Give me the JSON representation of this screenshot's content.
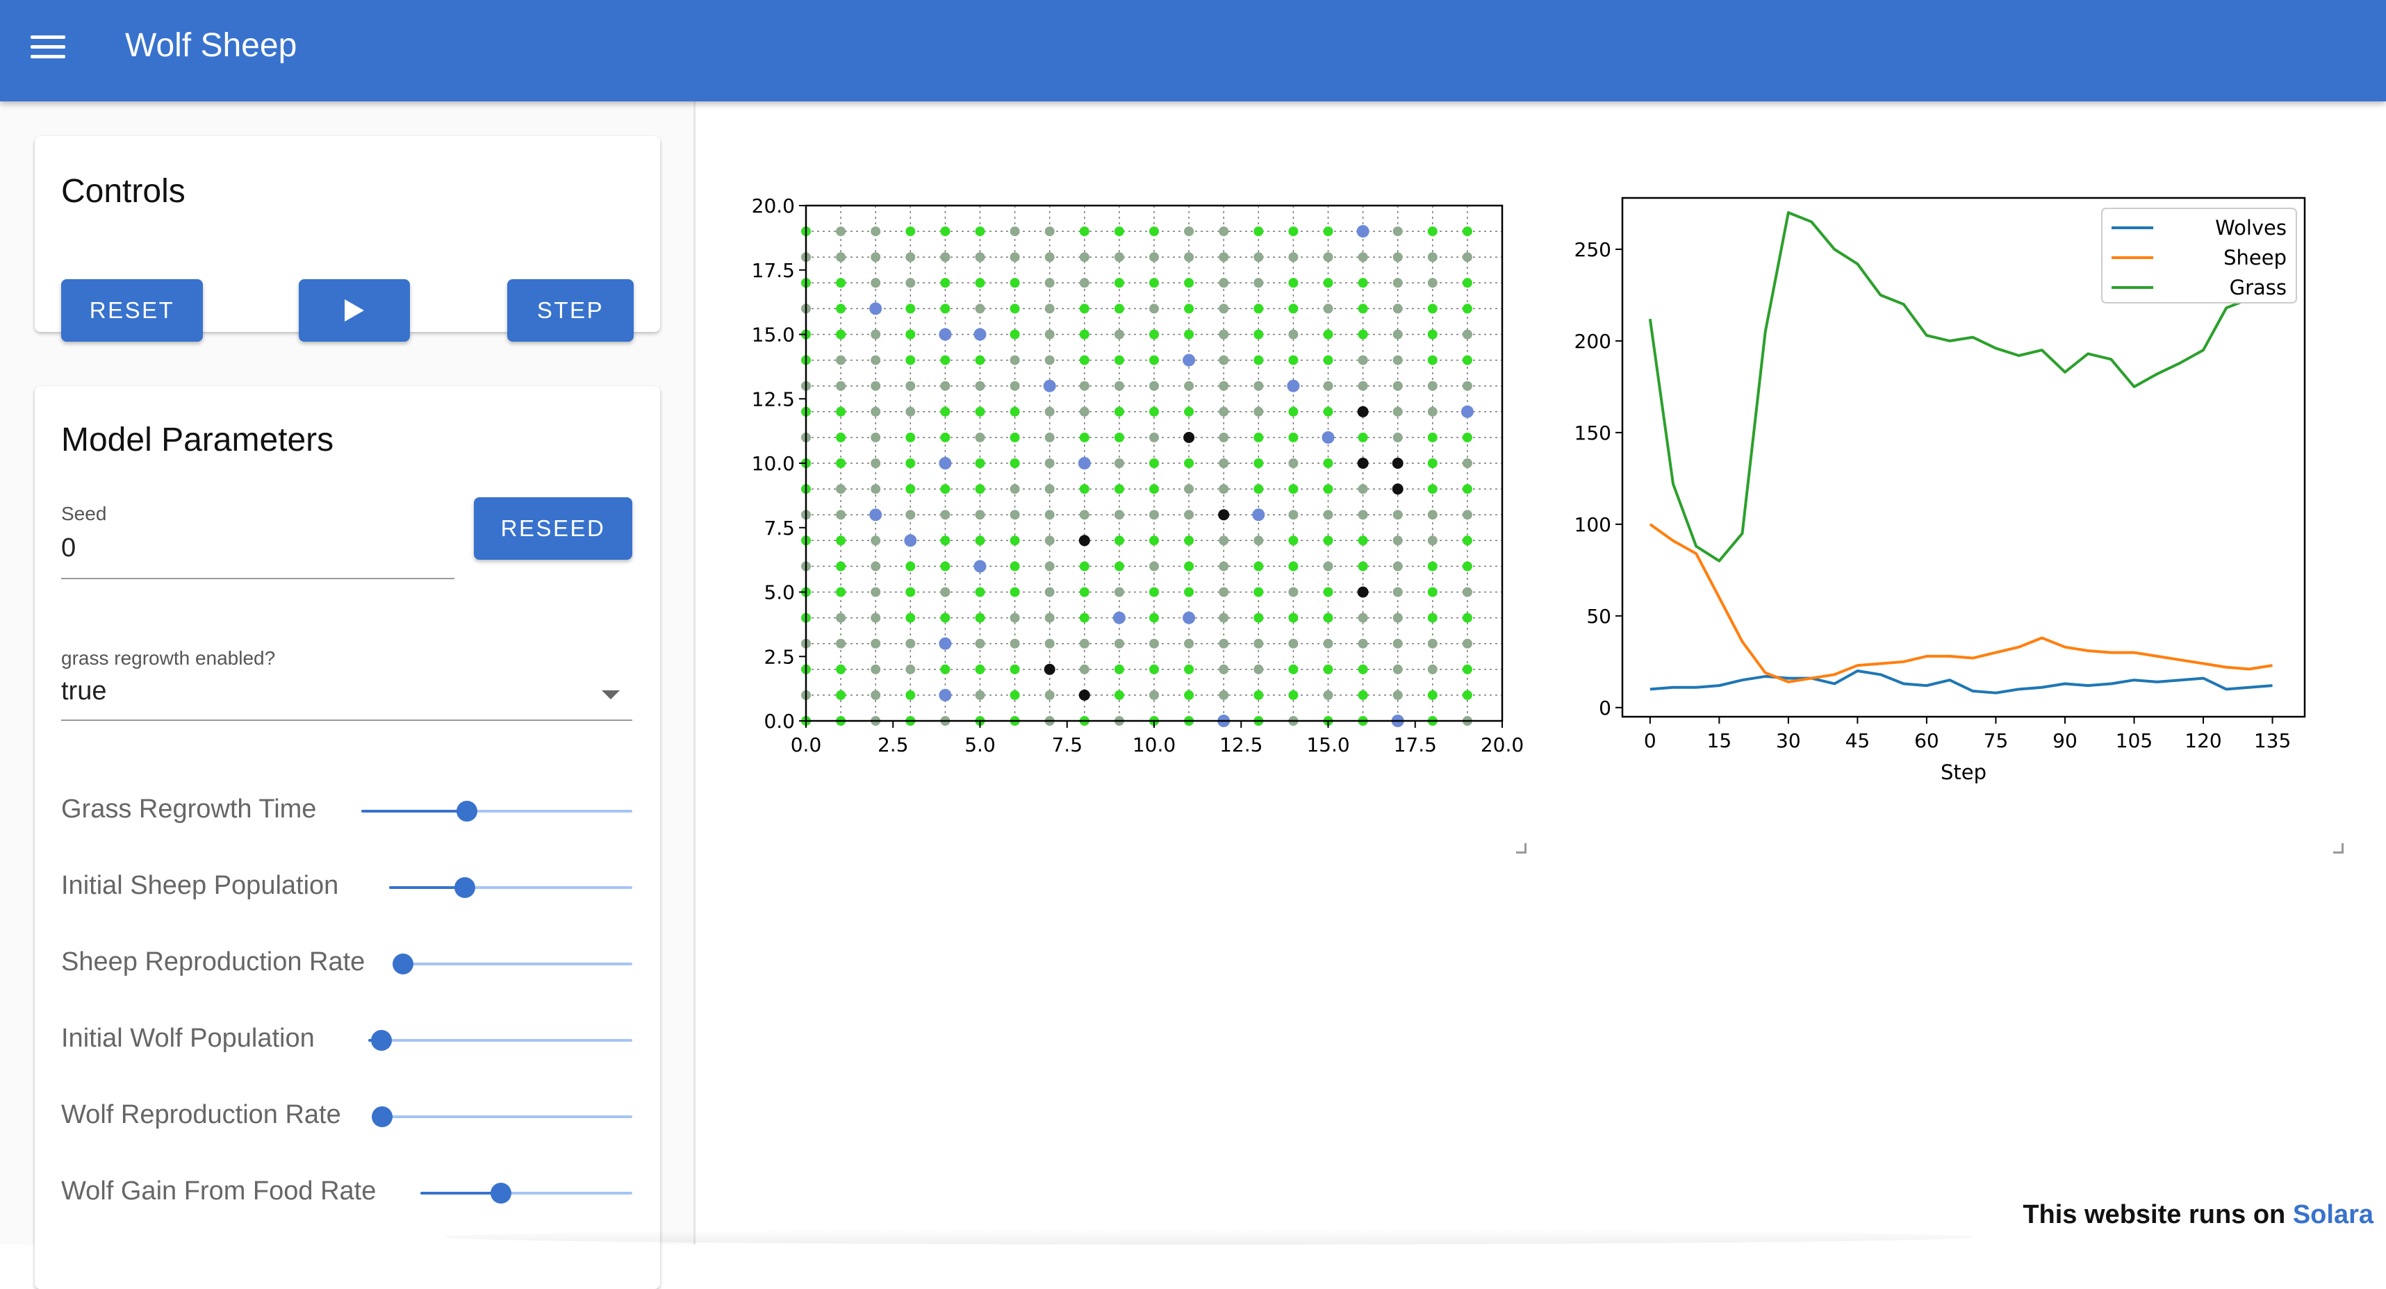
{
  "app": {
    "title": "Wolf Sheep"
  },
  "controls": {
    "title": "Controls",
    "reset_label": "RESET",
    "step_label": "STEP",
    "play_icon": "play-icon"
  },
  "model_parameters": {
    "title": "Model Parameters",
    "seed": {
      "label": "Seed",
      "value": "0"
    },
    "reseed_label": "RESEED",
    "grass_regrowth": {
      "label": "grass regrowth enabled?",
      "value": "true"
    },
    "sliders": [
      {
        "label": "Grass Regrowth Time",
        "fraction": 0.39
      },
      {
        "label": "Initial Sheep Population",
        "fraction": 0.31
      },
      {
        "label": "Sheep Reproduction Rate",
        "fraction": 0.0
      },
      {
        "label": "Initial Wolf Population",
        "fraction": 0.05
      },
      {
        "label": "Wolf Reproduction Rate",
        "fraction": 0.0
      },
      {
        "label": "Wolf Gain From Food Rate",
        "fraction": 0.38
      }
    ]
  },
  "grid_plot": {
    "x_ticks": [
      "0.0",
      "2.5",
      "5.0",
      "7.5",
      "10.0",
      "12.5",
      "15.0",
      "17.5",
      "20.0"
    ],
    "y_ticks": [
      "0.0",
      "2.5",
      "5.0",
      "7.5",
      "10.0",
      "12.5",
      "15.0",
      "17.5",
      "20.0"
    ],
    "xlim": [
      0,
      20
    ],
    "ylim": [
      0,
      20
    ],
    "colors": {
      "grass_full": "#33dd22",
      "grass_eaten": "#8faa8f",
      "sheep": "#6b89d6",
      "wolf": "#111111"
    },
    "sheep": [
      [
        2,
        16
      ],
      [
        4,
        15
      ],
      [
        5,
        15
      ],
      [
        16,
        19
      ],
      [
        11,
        14
      ],
      [
        7,
        13
      ],
      [
        14,
        13
      ],
      [
        19,
        12
      ],
      [
        15,
        11
      ],
      [
        4,
        10
      ],
      [
        8,
        10
      ],
      [
        2,
        8
      ],
      [
        13,
        8
      ],
      [
        3,
        7
      ],
      [
        5,
        6
      ],
      [
        9,
        4
      ],
      [
        11,
        4
      ],
      [
        4,
        3
      ],
      [
        4,
        1
      ],
      [
        12,
        0
      ],
      [
        17,
        0
      ]
    ],
    "wolves": [
      [
        16,
        12
      ],
      [
        11,
        11
      ],
      [
        16,
        10
      ],
      [
        17,
        10
      ],
      [
        17,
        9
      ],
      [
        12,
        8
      ],
      [
        8,
        7
      ],
      [
        16,
        5
      ],
      [
        7,
        2
      ],
      [
        8,
        1
      ]
    ]
  },
  "chart_data": {
    "type": "line",
    "title": "",
    "xlabel": "Step",
    "ylabel": "",
    "x_ticks": [
      0,
      15,
      30,
      45,
      60,
      75,
      90,
      105,
      120,
      135
    ],
    "y_ticks": [
      0,
      50,
      100,
      150,
      200,
      250
    ],
    "xlim": [
      -6,
      142
    ],
    "ylim": [
      -5,
      278
    ],
    "legend": "top-right",
    "x": [
      0,
      5,
      10,
      15,
      20,
      25,
      30,
      35,
      40,
      45,
      50,
      55,
      60,
      65,
      70,
      75,
      80,
      85,
      90,
      95,
      100,
      105,
      110,
      115,
      120,
      125,
      130,
      135
    ],
    "series": [
      {
        "name": "Wolves",
        "color": "#1f77b4",
        "values": [
          10,
          11,
          11,
          12,
          15,
          17,
          16,
          16,
          13,
          20,
          18,
          13,
          12,
          15,
          9,
          8,
          10,
          11,
          13,
          12,
          13,
          15,
          14,
          15,
          16,
          10,
          11,
          12
        ]
      },
      {
        "name": "Sheep",
        "color": "#ff7f0e",
        "values": [
          100,
          91,
          84,
          60,
          36,
          19,
          14,
          16,
          18,
          23,
          24,
          25,
          28,
          28,
          27,
          30,
          33,
          38,
          33,
          31,
          30,
          30,
          28,
          26,
          24,
          22,
          21,
          23
        ]
      },
      {
        "name": "Grass",
        "color": "#2ca02c",
        "values": [
          212,
          122,
          88,
          80,
          95,
          205,
          270,
          265,
          250,
          242,
          225,
          220,
          203,
          200,
          202,
          196,
          192,
          195,
          183,
          193,
          190,
          175,
          182,
          188,
          195,
          218,
          223,
          228
        ]
      }
    ]
  },
  "footer": {
    "text": "This website runs on ",
    "link": "Solara"
  }
}
